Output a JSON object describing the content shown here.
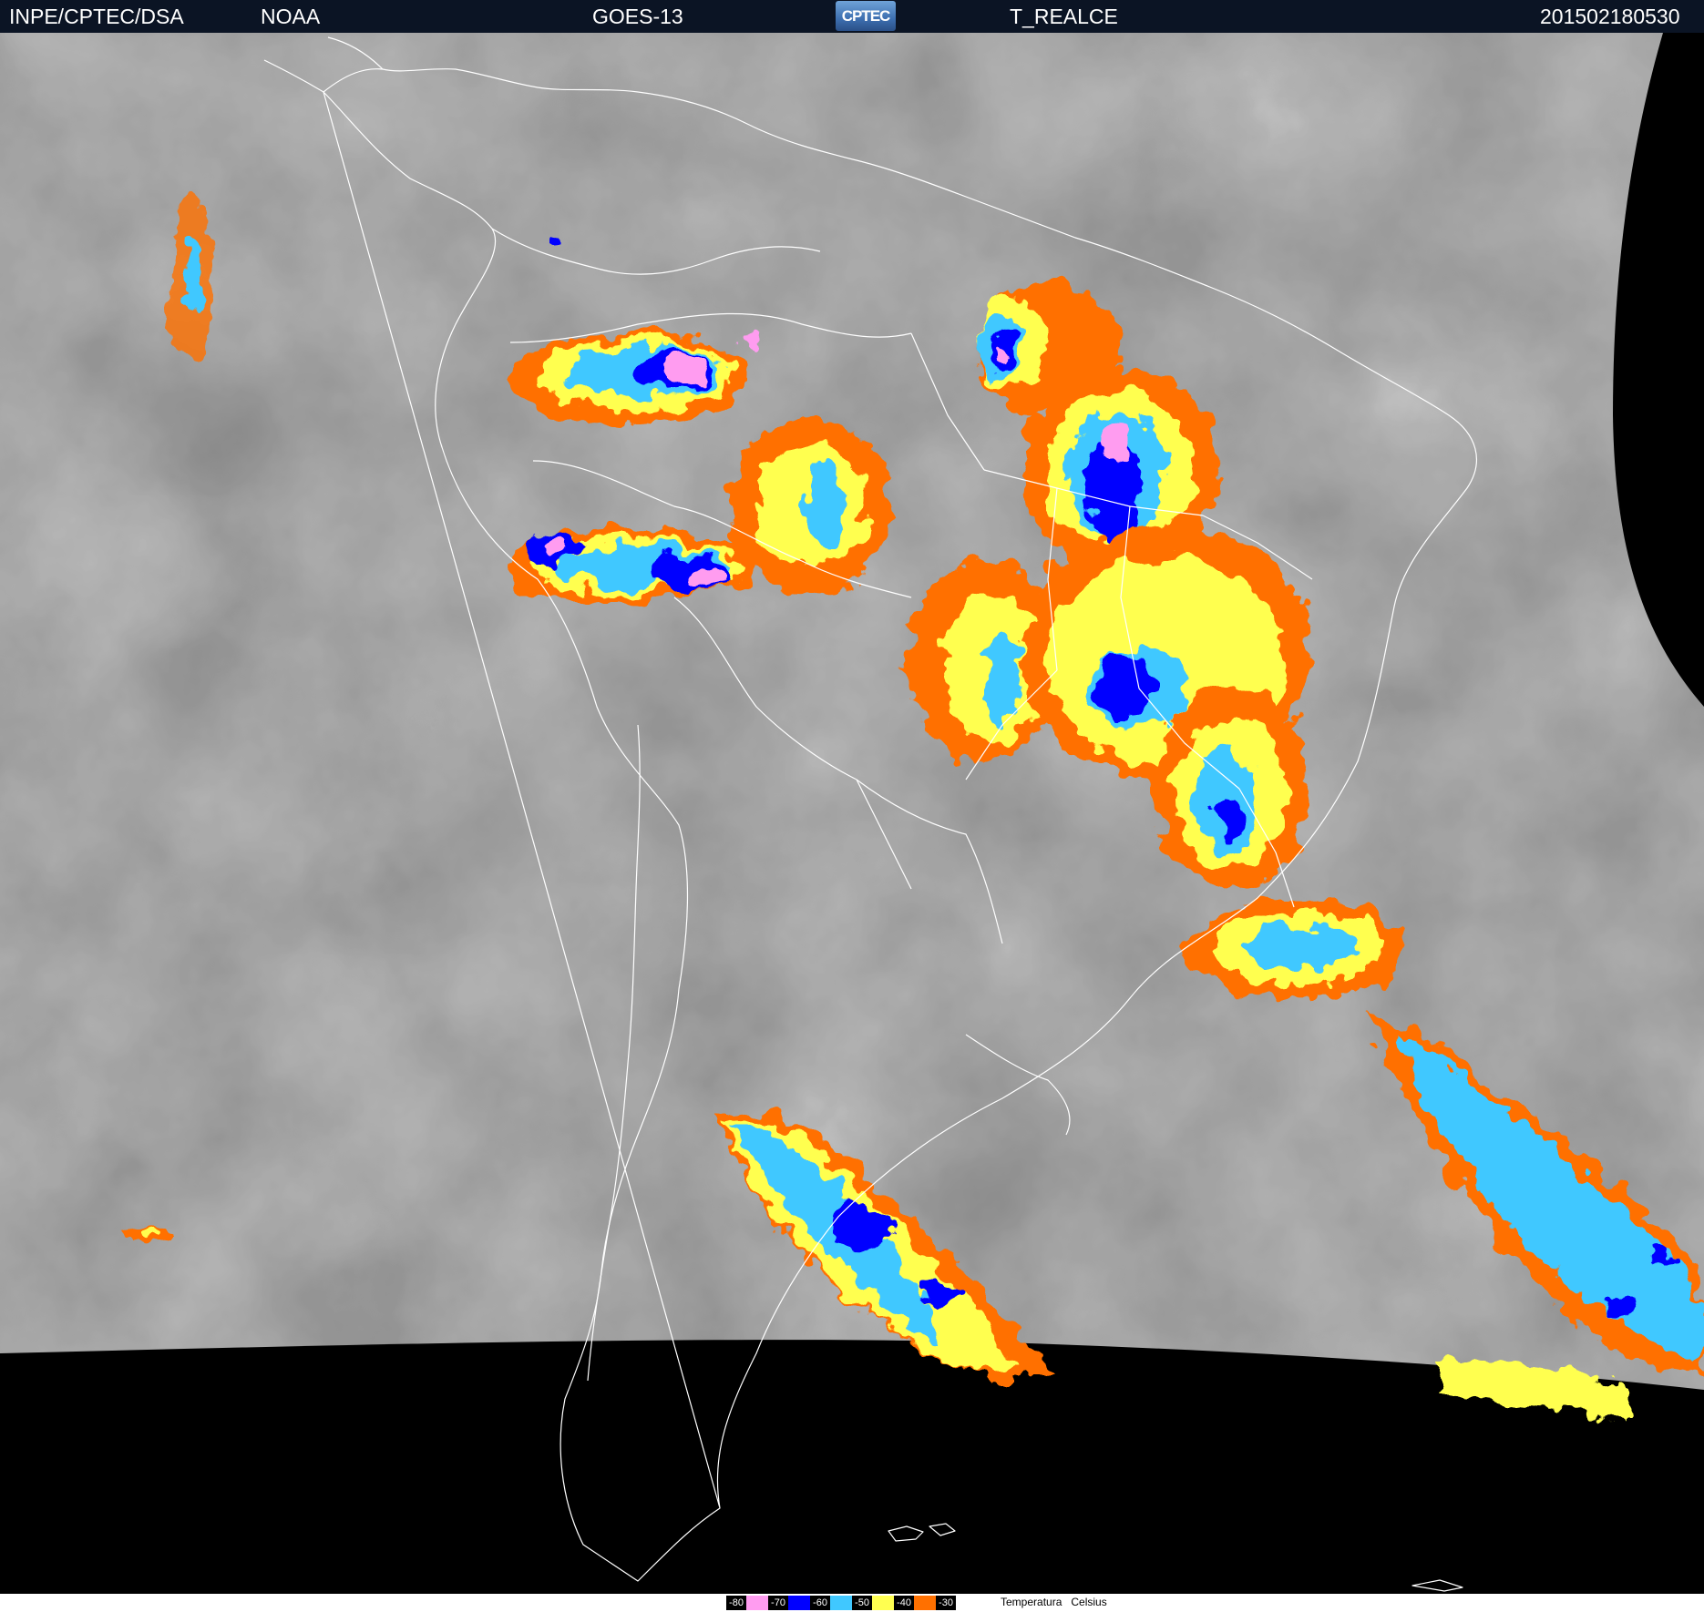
{
  "header": {
    "org": "INPE/CPTEC/DSA",
    "agency": "NOAA",
    "satellite": "GOES-13",
    "logo_text": "CPTEC",
    "product": "T_REALCE",
    "timestamp": "201502180530"
  },
  "legend": {
    "items": [
      {
        "label": "-80",
        "color": "#ff9cf0"
      },
      {
        "label": "-70",
        "color": "#0000ff"
      },
      {
        "label": "-60",
        "color": "#40c8ff"
      },
      {
        "label": "-50",
        "color": "#ffff50"
      },
      {
        "label": "-40",
        "color": "#ff7000"
      },
      {
        "label": "-30",
        "color": ""
      }
    ],
    "caption": "Temperatura   Celsius"
  },
  "colors": {
    "header_bg": "#0b1424",
    "space": "#000000",
    "borders": "#ffffff"
  }
}
